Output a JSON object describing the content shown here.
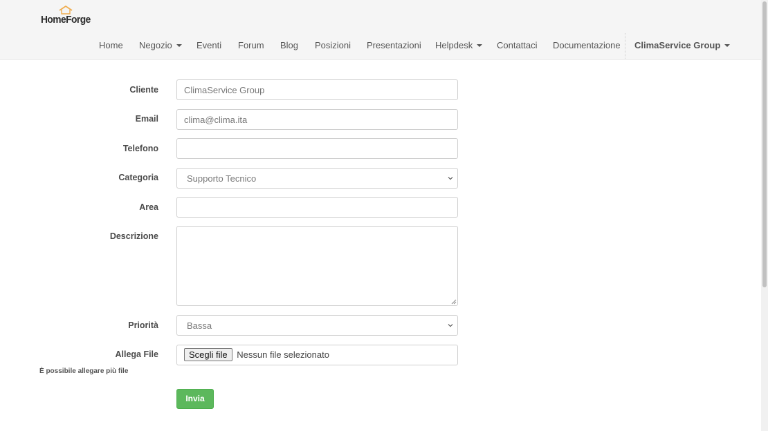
{
  "brand": {
    "name": "HomeForge",
    "icon": "house-roof-icon",
    "accent": "#f0ad4e"
  },
  "nav": {
    "items": [
      {
        "label": "Home"
      },
      {
        "label": "Negozio"
      },
      {
        "label": "Eventi"
      },
      {
        "label": "Forum"
      },
      {
        "label": "Blog"
      },
      {
        "label": "Posizioni"
      },
      {
        "label": "Presentazioni"
      },
      {
        "label": "Helpdesk"
      },
      {
        "label": "Contattaci"
      },
      {
        "label": "Documentazione"
      }
    ],
    "user": "ClimaService Group"
  },
  "form": {
    "cliente": {
      "label": "Cliente",
      "value": "ClimaService Group"
    },
    "email": {
      "label": "Email",
      "value": "clima@clima.ita"
    },
    "telefono": {
      "label": "Telefono",
      "value": ""
    },
    "categoria": {
      "label": "Categoria",
      "value": "Supporto Tecnico"
    },
    "area": {
      "label": "Area",
      "value": ""
    },
    "descrizione": {
      "label": "Descrizione",
      "value": ""
    },
    "priorita": {
      "label": "Priorità",
      "value": "Bassa"
    },
    "allegato": {
      "label": "Allega File",
      "button": "Scegli file",
      "status": "Nessun file selezionato",
      "hint": "È possibile allegare più file"
    },
    "submit": "Invia"
  },
  "colors": {
    "submit": "#5cb85c",
    "header_bg": "#f5f5f5"
  }
}
